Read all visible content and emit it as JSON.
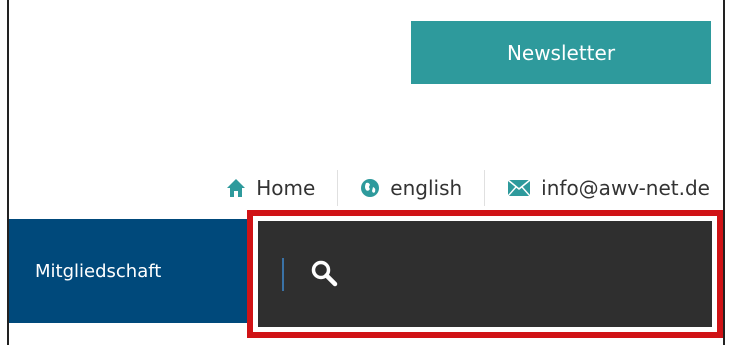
{
  "header": {
    "newsletter_label": "Newsletter"
  },
  "top_links": [
    {
      "label": "Home",
      "icon": "home-icon"
    },
    {
      "label": "english",
      "icon": "globe-icon"
    },
    {
      "label": "info@awv-net.de",
      "icon": "mail-icon"
    }
  ],
  "nav": {
    "items": [
      {
        "label": "Mitgliedschaft"
      }
    ]
  },
  "search": {
    "value": "",
    "placeholder": "",
    "icon": "search-icon",
    "highlight_color": "#d01316"
  },
  "colors": {
    "teal": "#2e9a9c",
    "nav_blue": "#00497b",
    "search_bg": "#2f2f2f"
  }
}
